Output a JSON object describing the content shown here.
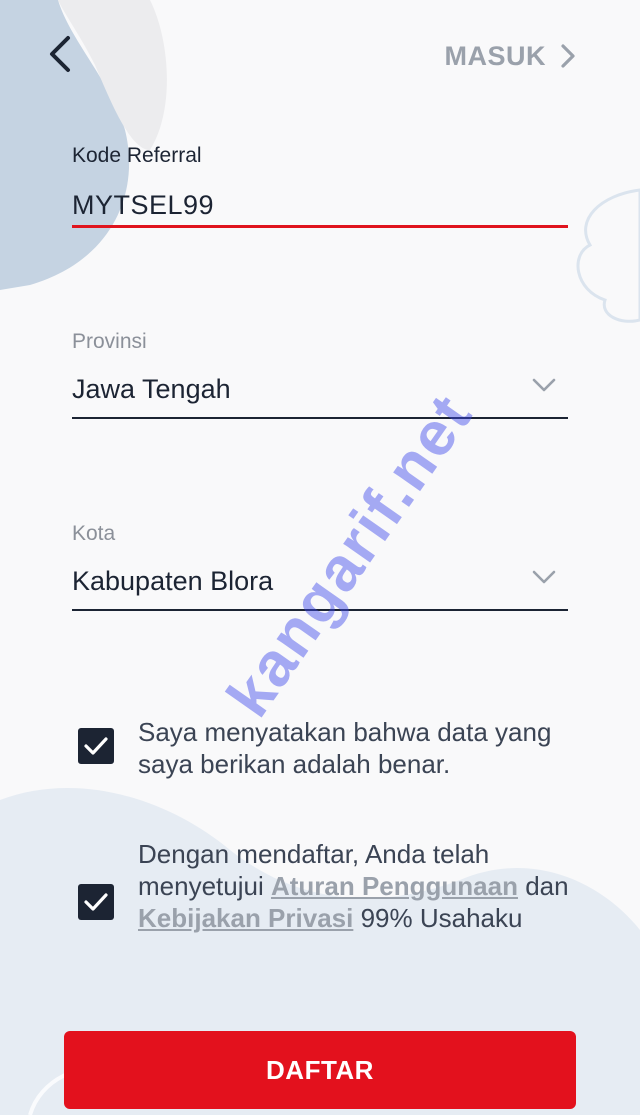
{
  "header": {
    "back_icon": "chevron-left-icon",
    "login_label": "MASUK",
    "login_icon": "chevron-right-icon"
  },
  "referral": {
    "label": "Kode Referral",
    "value": "MYTSEL99"
  },
  "province": {
    "label": "Provinsi",
    "value": "Jawa Tengah",
    "icon": "chevron-down-icon"
  },
  "city": {
    "label": "Kota",
    "value": "Kabupaten Blora",
    "icon": "chevron-down-icon"
  },
  "consents": {
    "data_true": {
      "checked": true,
      "text": "Saya menyatakan bahwa data yang saya berikan adalah benar."
    },
    "terms": {
      "checked": true,
      "text_1": "Dengan mendaftar, Anda telah menyetujui ",
      "terms_link": "Aturan Penggunaan",
      "text_2": " dan ",
      "privacy_link": "Kebijakan Privasi",
      "text_3": " 99% Usahaku"
    }
  },
  "watermark": "kangarif.net",
  "submit_label": "DAFTAR",
  "colors": {
    "primary": "#e3111d",
    "text_dark": "#1c2433",
    "muted": "#9aa1ab",
    "background": "#f9f9fa",
    "decor": "#c5d3e2"
  }
}
